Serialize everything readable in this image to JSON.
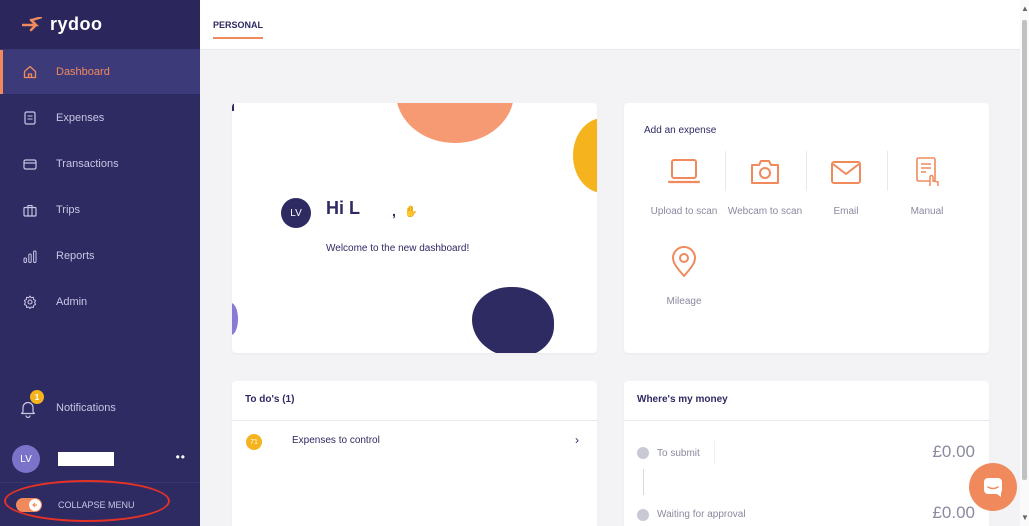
{
  "brand": {
    "name": "rydoo"
  },
  "colors": {
    "sidebar": "#2e2a62",
    "accent": "#f08a5d",
    "badge": "#f5b41e"
  },
  "sidebar": {
    "items": [
      {
        "label": "Dashboard",
        "icon": "home-icon",
        "active": true
      },
      {
        "label": "Expenses",
        "icon": "receipt-icon",
        "active": false
      },
      {
        "label": "Transactions",
        "icon": "card-icon",
        "active": false
      },
      {
        "label": "Trips",
        "icon": "suitcase-icon",
        "active": false
      },
      {
        "label": "Reports",
        "icon": "bar-chart-icon",
        "active": false
      },
      {
        "label": "Admin",
        "icon": "gear-icon",
        "active": false
      }
    ],
    "notifications": {
      "label": "Notifications",
      "badge": "1"
    },
    "user": {
      "initials": "LV",
      "more": "••"
    },
    "collapse_label": "COLLAPSE MENU"
  },
  "topbar": {
    "tab": "PERSONAL"
  },
  "welcome": {
    "initials": "LV",
    "greeting": "Hi L",
    "comma": ",",
    "message": "Welcome to the new dashboard!"
  },
  "add_expense": {
    "title": "Add an expense",
    "actions": [
      {
        "label": "Upload to scan",
        "icon": "laptop-icon"
      },
      {
        "label": "Webcam to scan",
        "icon": "camera-icon"
      },
      {
        "label": "Email",
        "icon": "envelope-icon"
      },
      {
        "label": "Manual",
        "icon": "manual-entry-icon"
      },
      {
        "label": "Mileage",
        "icon": "location-pin-icon"
      }
    ]
  },
  "todos": {
    "title": "To do's (1)",
    "items": [
      {
        "count": "71",
        "label": "Expenses to control"
      }
    ]
  },
  "money": {
    "title": "Where's my money",
    "rows": [
      {
        "label": "To submit",
        "amount": "£0.00"
      },
      {
        "label": "Waiting for approval",
        "amount": "£0.00"
      }
    ]
  }
}
